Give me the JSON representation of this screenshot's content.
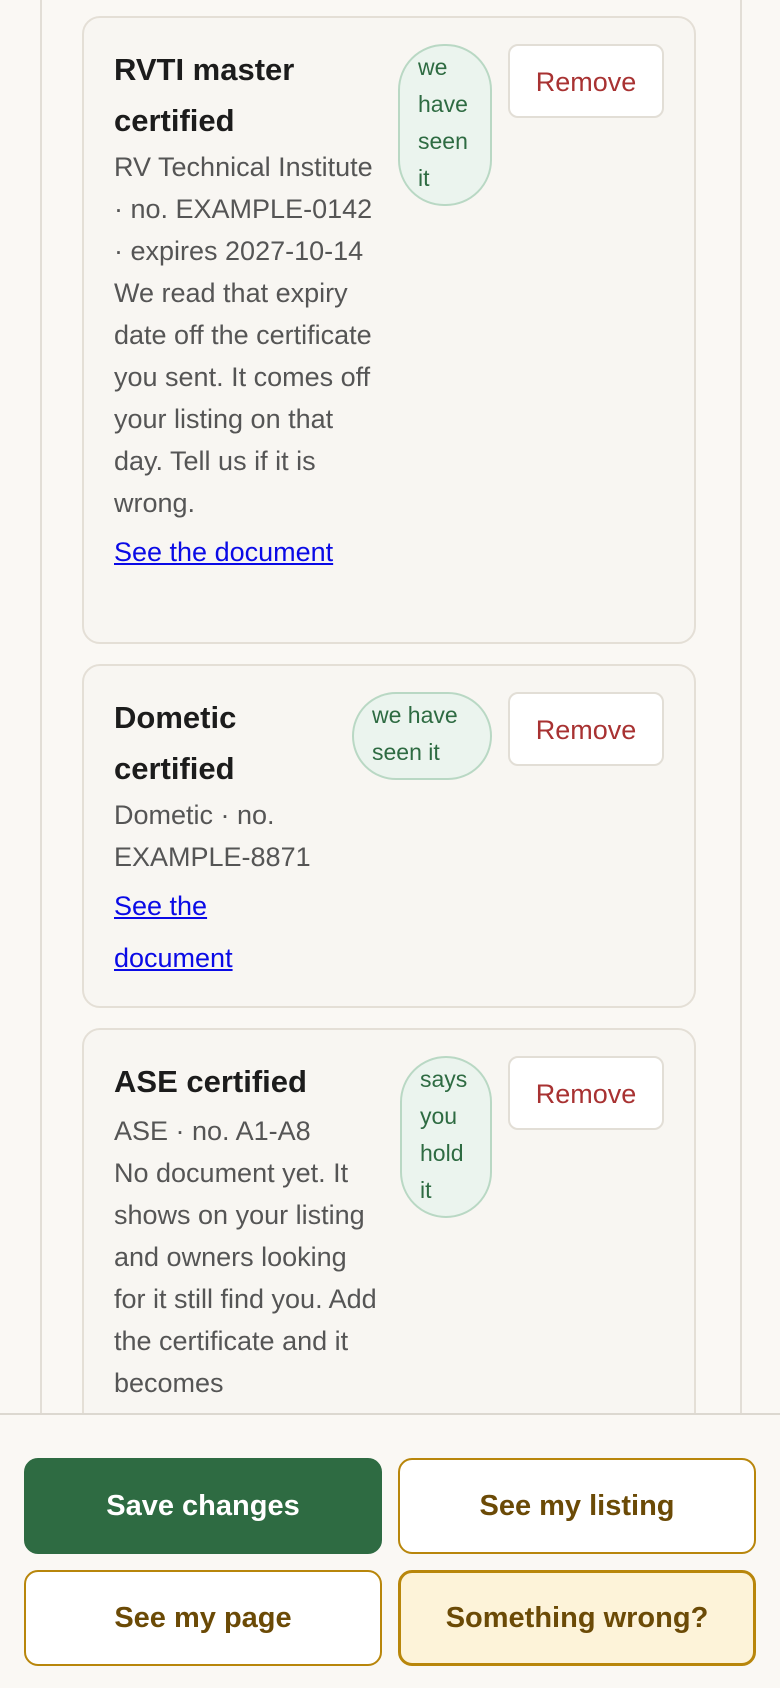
{
  "certifications": [
    {
      "title": "RVTI master certified",
      "issuer_line": "RV Technical Institute · no. EXAMPLE-0142 · expires 2027-10-14",
      "note": "We read that expiry date off the certificate you sent. It comes off your listing on that day. Tell us if it is wrong.",
      "badge": "we have seen it",
      "link": "See the document",
      "remove": "Remove"
    },
    {
      "title": "Dometic certified",
      "issuer_line": "Dometic · no. EXAMPLE-8871",
      "note": "",
      "badge": "we have seen it",
      "link": "See the document",
      "remove": "Remove"
    },
    {
      "title": "ASE certified",
      "issuer_line": "ASE · no. A1-A8",
      "note": "No document yet. It shows on your listing and owners looking for it still find you. Add the certificate and it becomes",
      "badge": "says you hold it",
      "remove": "Remove"
    }
  ],
  "footer": {
    "save": "Save changes",
    "see_listing": "See my listing",
    "see_page": "See my page",
    "something_wrong": "Something wrong?"
  },
  "colors": {
    "primary_green": "#2e6b42",
    "badge_bg": "#ebf4ee",
    "remove_red": "#a83232",
    "gold_border": "#b8860b",
    "link_blue": "#0a0ae6"
  }
}
